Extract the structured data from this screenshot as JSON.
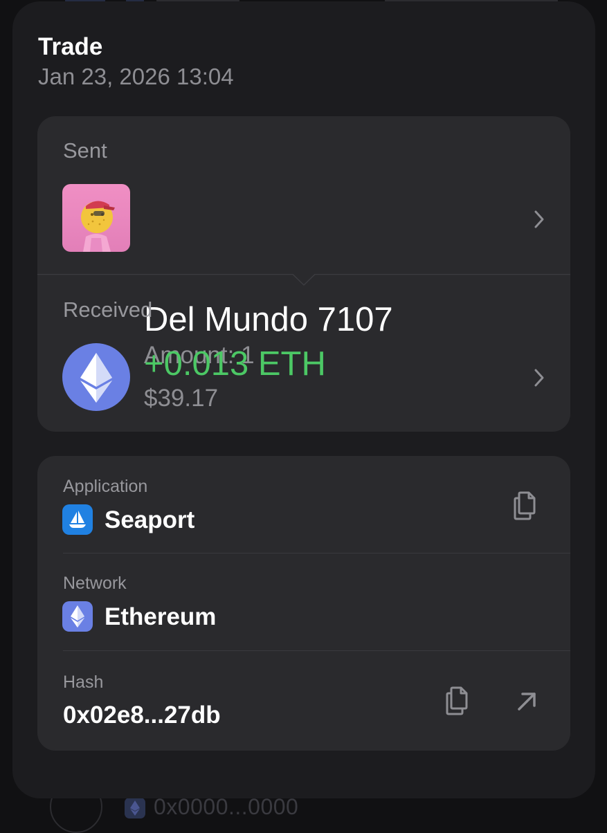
{
  "header": {
    "title": "Trade",
    "date": "Jan 23, 2026 13:04"
  },
  "sent": {
    "label": "Sent",
    "name": "Del Mundo 7107",
    "amount": "Amount: 1",
    "icon": "nft-thumbnail"
  },
  "received": {
    "label": "Received",
    "amount": "+0.013 ETH",
    "usd": "$39.17",
    "icon": "eth-coin-icon"
  },
  "details": {
    "application": {
      "label": "Application",
      "value": "Seaport",
      "icon": "seaport-icon"
    },
    "network": {
      "label": "Network",
      "value": "Ethereum",
      "icon": "ethereum-icon"
    },
    "hash": {
      "label": "Hash",
      "value": "0x02e8...27db"
    }
  },
  "background": {
    "hash_text": "0x0000...0000"
  },
  "colors": {
    "background": "#111113",
    "sheet": "#1c1c1f",
    "card": "#2a2a2d",
    "positive": "#4cc865",
    "muted": "#8e8e93",
    "eth": "#6a80e4",
    "seaport": "#2081e2"
  }
}
